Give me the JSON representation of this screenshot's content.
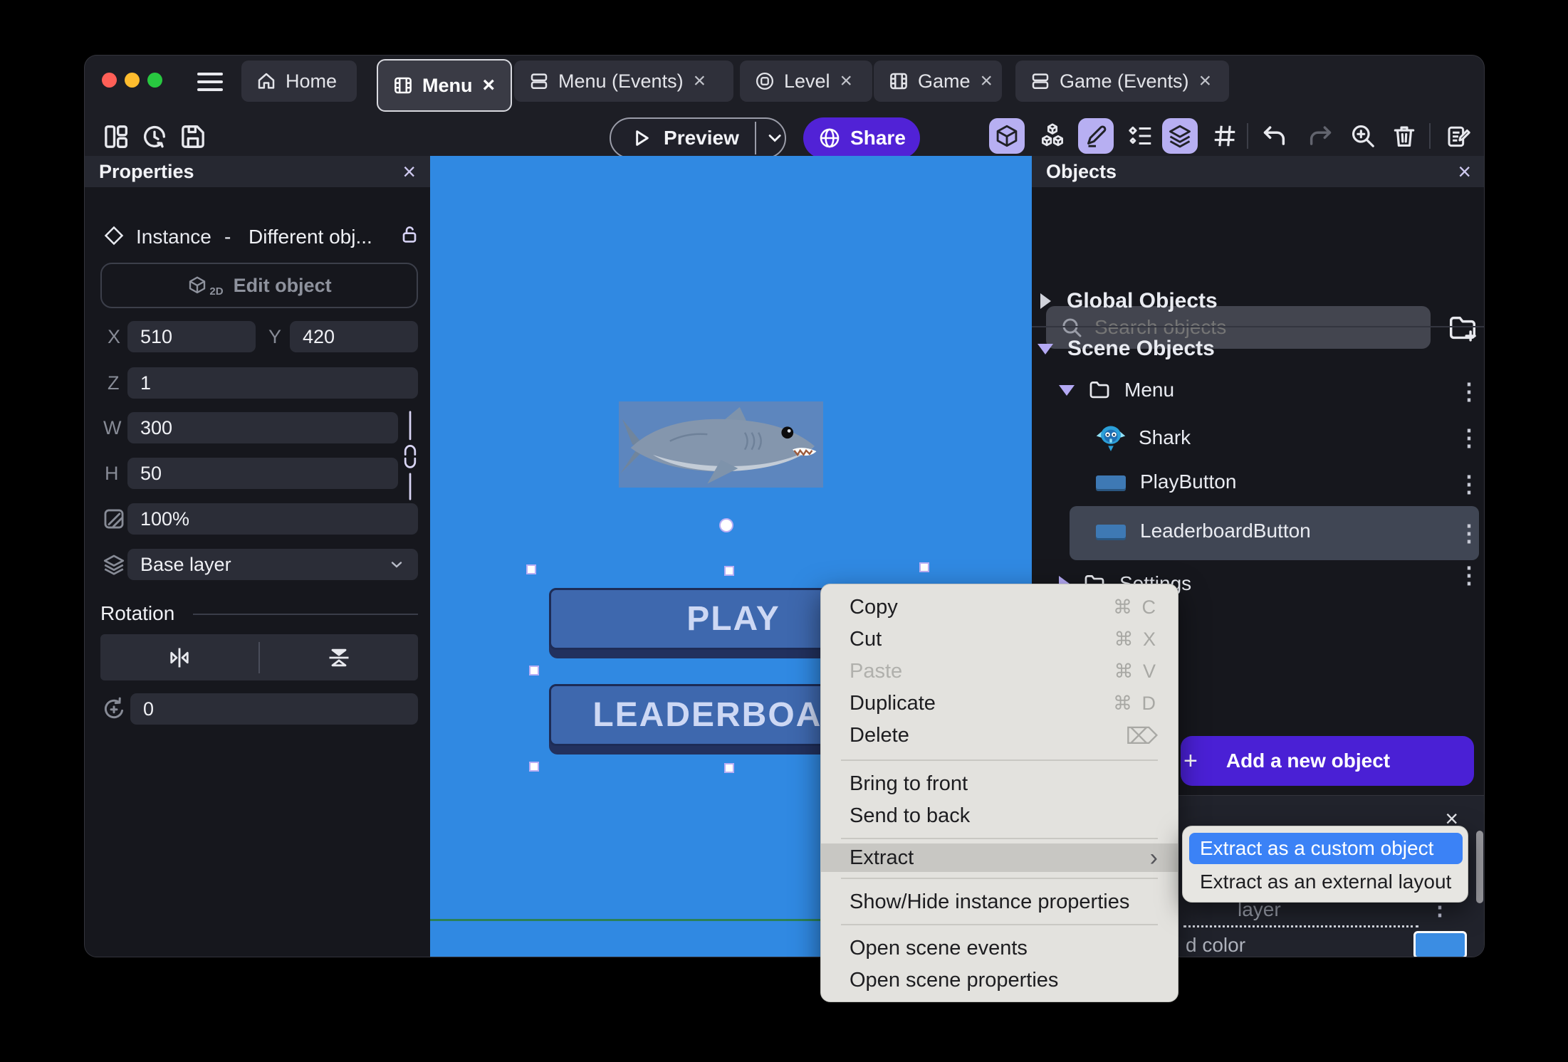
{
  "window": {
    "traffic_lights": {
      "red": "#ff5f57",
      "yellow": "#febc2e",
      "green": "#28c840"
    },
    "tabs": [
      {
        "label": "Home",
        "icon": "home-icon",
        "active": false,
        "closable": false
      },
      {
        "label": "Menu",
        "icon": "scene-icon",
        "active": true,
        "closable": true
      },
      {
        "label": "Menu (Events)",
        "icon": "events-icon",
        "active": false,
        "closable": true
      },
      {
        "label": "Level",
        "icon": "external-layout-icon",
        "active": false,
        "closable": true
      },
      {
        "label": "Game",
        "icon": "scene-icon",
        "active": false,
        "closable": true
      },
      {
        "label": "Game (Events)",
        "icon": "events-icon",
        "active": false,
        "closable": true
      }
    ]
  },
  "toolbar": {
    "preview_label": "Preview",
    "share_label": "Share",
    "accent_purple": "#5122d6",
    "active_chip_color": "#b7aff2"
  },
  "properties": {
    "title": "Properties",
    "instance_label": "Instance",
    "instance_sep": "-",
    "instance_value": "Different obj...",
    "edit_object_label": "Edit object",
    "edit_object_badge": "2D",
    "x_label": "X",
    "x_value": "510",
    "y_label": "Y",
    "y_value": "420",
    "z_label": "Z",
    "z_value": "1",
    "w_label": "W",
    "w_value": "300",
    "h_label": "H",
    "h_value": "50",
    "opacity_value": "100%",
    "layer_value": "Base layer",
    "rotation_title": "Rotation",
    "rotation_value": "0"
  },
  "canvas": {
    "background_color": "#3089e2",
    "scene_border_color": "#2b8156",
    "play_label": "PLAY",
    "leaderboard_label": "LEADERBOARD"
  },
  "context_menu": {
    "items": [
      {
        "label": "Copy",
        "shortcut": "⌘ C"
      },
      {
        "label": "Cut",
        "shortcut": "⌘ X"
      },
      {
        "label": "Paste",
        "shortcut": "⌘ V",
        "disabled": true
      },
      {
        "label": "Duplicate",
        "shortcut": "⌘ D"
      },
      {
        "label": "Delete",
        "shortcut": "⌦"
      },
      {
        "label": "Bring to front"
      },
      {
        "label": "Send to back"
      },
      {
        "label": "Extract",
        "highlighted": true,
        "has_submenu": true
      },
      {
        "label": "Show/Hide instance properties"
      },
      {
        "label": "Open scene events"
      },
      {
        "label": "Open scene properties"
      }
    ]
  },
  "extract_submenu": {
    "items": [
      {
        "label": "Extract as a custom object",
        "selected": true
      },
      {
        "label": "Extract as an external layout",
        "selected": false
      }
    ],
    "selected_color": "#3b82f6"
  },
  "objects": {
    "title": "Objects",
    "search_placeholder": "Search objects",
    "global_label": "Global Objects",
    "scene_label": "Scene Objects",
    "folder_menu": "Menu",
    "item_shark": "Shark",
    "item_play": "PlayButton",
    "item_leaderboard": "LeaderboardButton",
    "folder_settings": "Settings",
    "add_button_label": "Add a new object",
    "add_button_plus": "+"
  },
  "mini_panel": {
    "row1": "layer",
    "row2": "d color",
    "swatch_color": "#3b8de3"
  }
}
